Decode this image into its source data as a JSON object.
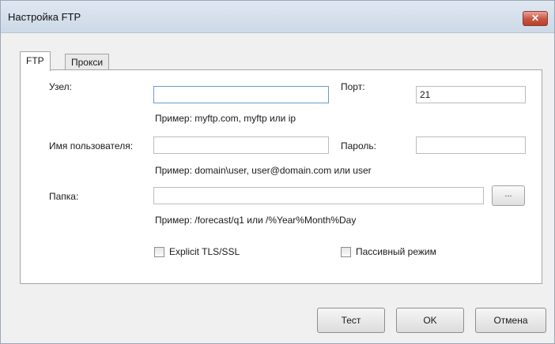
{
  "window": {
    "title": "Настройка FTP"
  },
  "tabs": [
    {
      "label": "FTP",
      "selected": true
    },
    {
      "label": "Прокси",
      "selected": false
    }
  ],
  "ftp": {
    "host": {
      "label": "Узел:",
      "value": "",
      "hint": "Пример: myftp.com, myftp или ip"
    },
    "port": {
      "label": "Порт:",
      "value": "21"
    },
    "user": {
      "label": "Имя пользователя:",
      "value": "",
      "hint": "Пример: domain\\user, user@domain.com или user"
    },
    "password": {
      "label": "Пароль:",
      "value": ""
    },
    "folder": {
      "label": "Папка:",
      "value": "",
      "hint": "Пример: /forecast/q1 или /%Year%Month%Day",
      "browse_label": "..."
    },
    "explicit_tls": {
      "label": "Explicit TLS/SSL",
      "checked": false
    },
    "passive": {
      "label": "Пассивный режим",
      "checked": false
    }
  },
  "buttons": {
    "test": "Тест",
    "ok": "OK",
    "cancel": "Отмена"
  }
}
